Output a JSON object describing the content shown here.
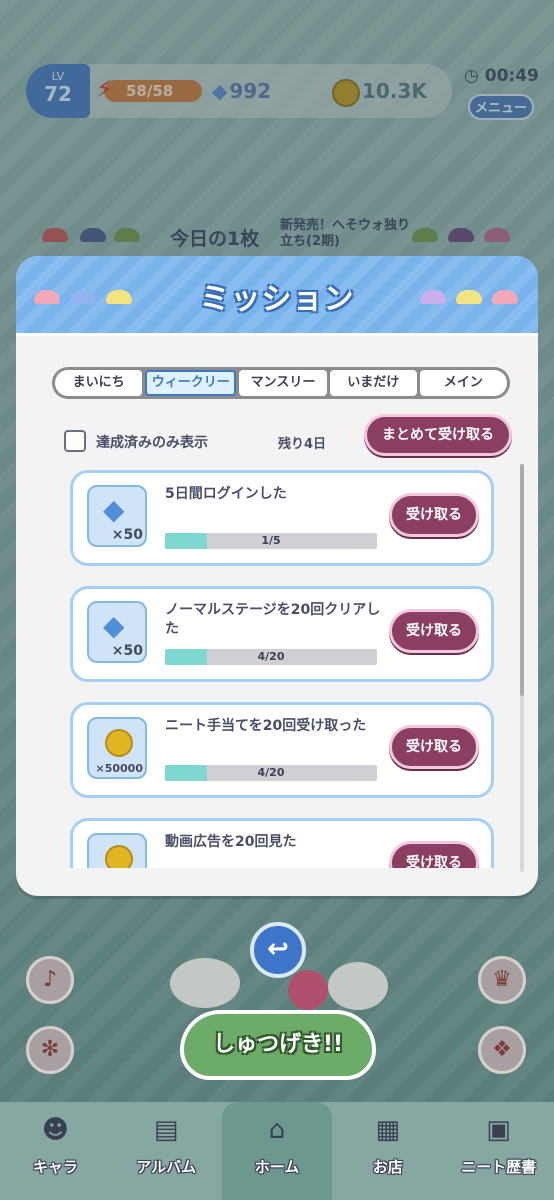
{
  "status": {
    "level_label": "LV",
    "level": "72",
    "energy": "58/58",
    "gems": "992",
    "coins": "10.3K",
    "time": "00:49",
    "menu_label": "メニュー"
  },
  "banner": {
    "title": "今日の1枚",
    "subtitle": "新発売！へそウォ独り立ち(2期)"
  },
  "mission": {
    "title": "ミッション",
    "tabs": [
      {
        "label": "まいにち",
        "active": false
      },
      {
        "label": "ウィークリー",
        "active": true
      },
      {
        "label": "マンスリー",
        "active": false
      },
      {
        "label": "いまだけ",
        "active": false
      },
      {
        "label": "メイン",
        "active": false
      }
    ],
    "filter_label": "達成済みのみ表示",
    "remaining": "残り4日",
    "claim_all_label": "まとめて受け取る",
    "items": [
      {
        "reward_icon": "gem-icon",
        "quantity": "×50",
        "title": "5日間ログインした",
        "progress_text": "1/5",
        "progress": 0.2,
        "claim_label": "受け取る"
      },
      {
        "reward_icon": "gem-icon",
        "quantity": "×50",
        "title": "ノーマルステージを20回クリアした",
        "progress_text": "4/20",
        "progress": 0.2,
        "claim_label": "受け取る"
      },
      {
        "reward_icon": "coin-icon",
        "quantity": "×50000",
        "title": "ニート手当てを20回受け取った",
        "progress_text": "4/20",
        "progress": 0.2,
        "claim_label": "受け取る"
      },
      {
        "reward_icon": "coin-icon",
        "quantity": "",
        "title": "動画広告を20回見た",
        "progress_text": "",
        "progress": 0,
        "claim_label": "受け取る"
      }
    ]
  },
  "scene": {
    "launch_label": "しゅつげき!!"
  },
  "nav": [
    {
      "label": "キャラ",
      "icon": "character-icon",
      "active": false
    },
    {
      "label": "アルバム",
      "icon": "album-icon",
      "active": false
    },
    {
      "label": "ホーム",
      "icon": "home-icon",
      "active": true
    },
    {
      "label": "お店",
      "icon": "shop-icon",
      "active": false
    },
    {
      "label": "ニート歴書",
      "icon": "resume-icon",
      "active": false
    }
  ],
  "colors": {
    "accent_blue": "#3b79c4",
    "claim_button": "#8a3f62",
    "progress_fill": "#7fd8d0"
  }
}
